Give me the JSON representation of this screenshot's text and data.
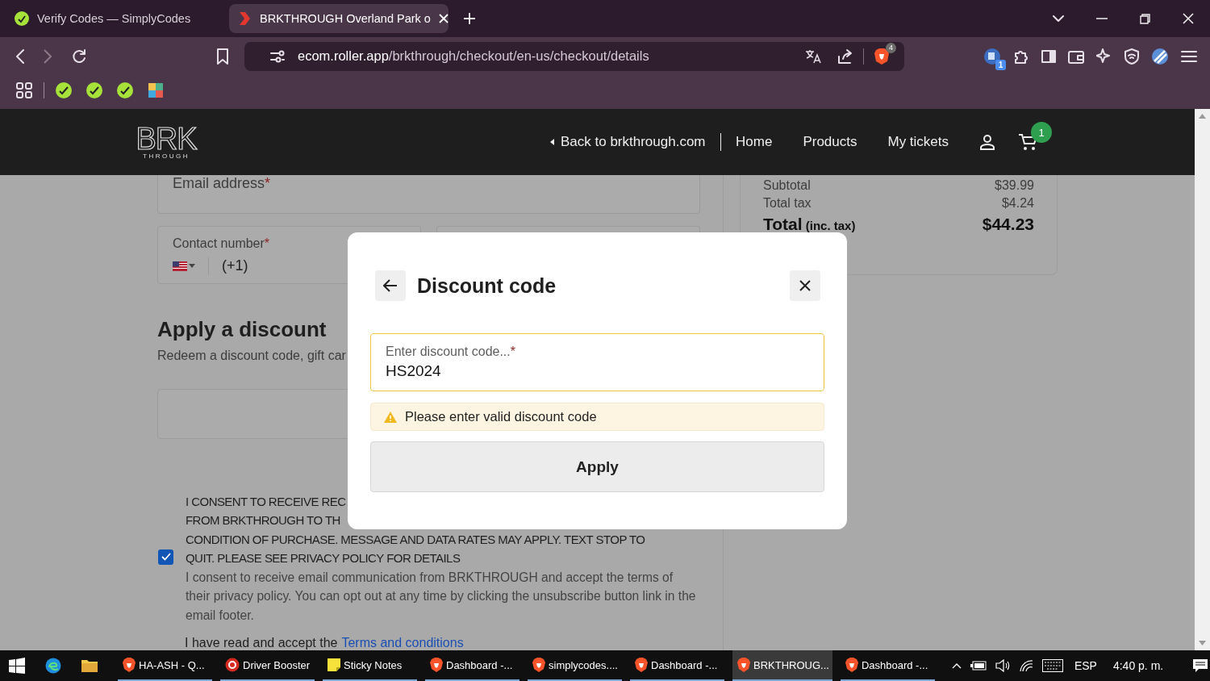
{
  "browser": {
    "tabs": [
      {
        "title": "Verify Codes — SimplyCodes",
        "selected": false,
        "kind": "simplycodes"
      },
      {
        "title": "BRKTHROUGH Overland Park o",
        "selected": true,
        "kind": "brk"
      }
    ],
    "url_host": "ecom.roller.app",
    "url_path": "/brkthrough/checkout/en-us/checkout/details",
    "shield_count": "4",
    "extension_count": "1"
  },
  "site_header": {
    "logo": {
      "main": "BRK",
      "sub": "THROUGH"
    },
    "back_link": "Back to brkthrough.com",
    "nav": [
      {
        "label": "Home"
      },
      {
        "label": "Products"
      },
      {
        "label": "My tickets"
      }
    ],
    "cart_count": "1"
  },
  "form": {
    "email": {
      "label": "Email address",
      "required_mark": "*"
    },
    "contact": {
      "label": "Contact number",
      "required_mark": "*",
      "prefix": "(+1)"
    },
    "discount_heading": "Apply a discount",
    "discount_subtitle": "Redeem a discount code, gift car",
    "consent": {
      "checked": true,
      "lines": [
        "I CONSENT TO RECEIVE REC",
        "FROM BRKTHROUGH TO TH",
        "CONDITION OF PURCHASE. MESSAGE AND DATA RATES MAY APPLY. TEXT STOP TO",
        "QUIT. PLEASE SEE PRIVACY POLICY FOR DETAILS"
      ],
      "note": "I consent to receive email communication from BRKTHROUGH and accept the terms of their privacy policy. You can opt out at any time by clicking the unsubscribe button link in the email footer."
    },
    "terms": {
      "text": "I have read and accept the",
      "link": "Terms and conditions"
    }
  },
  "summary": {
    "rows": [
      {
        "label": "Subtotal",
        "value": "$39.99"
      },
      {
        "label": "Total tax",
        "value": "$4.24"
      }
    ],
    "total": {
      "label": "Total",
      "note": "(inc. tax)",
      "value": "$44.23"
    }
  },
  "modal": {
    "title": "Discount code",
    "field": {
      "label": "Enter discount code...",
      "required_mark": "*",
      "value": "HS2024"
    },
    "warning": "Please enter valid discount code",
    "apply": "Apply"
  },
  "taskbar": {
    "apps": [
      {
        "label": "HA-ASH - Q...",
        "kind": "brave",
        "selected": false
      },
      {
        "label": "Driver Booster",
        "kind": "booster",
        "selected": false
      },
      {
        "label": "Sticky Notes",
        "kind": "sticky",
        "selected": false
      },
      {
        "label": "Dashboard -...",
        "kind": "brave",
        "selected": false
      },
      {
        "label": "simplycodes....",
        "kind": "brave",
        "selected": false
      },
      {
        "label": "Dashboard -...",
        "kind": "brave",
        "selected": false
      },
      {
        "label": "BRKTHROUG...",
        "kind": "brave",
        "selected": true
      },
      {
        "label": "Dashboard -...",
        "kind": "brave",
        "selected": false
      }
    ],
    "language": "ESP",
    "time": "4:40 p. m."
  }
}
